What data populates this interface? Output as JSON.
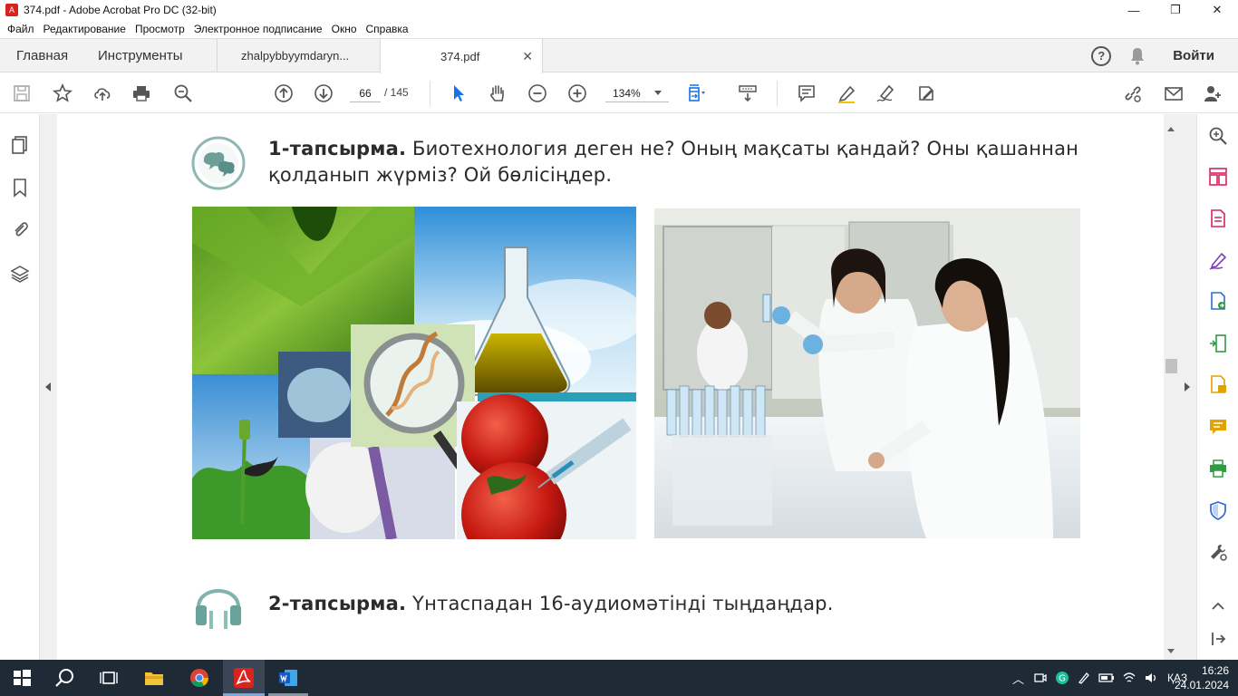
{
  "window": {
    "title": "374.pdf - Adobe Acrobat Pro DC (32-bit)",
    "minimize": "—",
    "maximize": "❐",
    "close": "✕"
  },
  "menu": [
    "Файл",
    "Редактирование",
    "Просмотр",
    "Электронное подписание",
    "Окно",
    "Справка"
  ],
  "tabs": {
    "home": "Главная",
    "tools": "Инструменты",
    "doc1": "zhalpybbyymdaryn...",
    "doc2": "374.pdf",
    "close": "✕",
    "help": "?",
    "signin": "Войти"
  },
  "toolbar": {
    "page_current": "66",
    "page_total": "/  145",
    "zoom": "134%"
  },
  "document": {
    "task1_label": "1-тапсырма.",
    "task1_text_line1": " Биотехнология деген не? Оның мақсаты қандай? Оны қашаннан",
    "task1_text_line2": "қолданып жүрміз? Ой бөлісіңдер.",
    "task2_label": "2-тапсырма.",
    "task2_text": " Үнтаспадан 16-аудиомәтінді тыңдаңдар."
  },
  "taskbar": {
    "language": "ҚАЗ",
    "time": "16:26",
    "date": "24.01.2024",
    "chevron": "︿"
  },
  "colors": {
    "acrobat_red": "#d9231e",
    "select_blue": "#1473e6",
    "tool_pink": "#d9235b",
    "tool_green": "#2d9d3f",
    "tool_yellow": "#e2a200",
    "tool_blue": "#2d6bd4",
    "taskbar": "#1f2a37"
  }
}
